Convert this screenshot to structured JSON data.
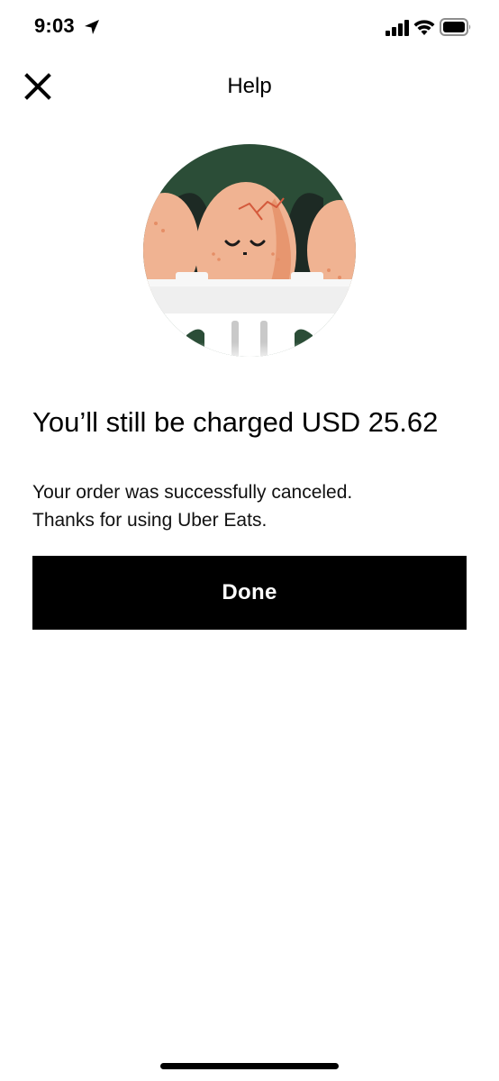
{
  "status_bar": {
    "time": "9:03",
    "icons": [
      "location-arrow-icon",
      "cellular-signal-icon",
      "wifi-icon",
      "battery-icon"
    ]
  },
  "nav": {
    "close_icon": "close-icon",
    "title": "Help"
  },
  "illustration": {
    "name": "cracked-egg-illustration",
    "colors": {
      "background_green": "#2b4d37",
      "egg": "#f0b392",
      "egg_shadow": "#e58e66",
      "carton": "#f2f2f2"
    }
  },
  "content": {
    "headline": "You’ll still be charged USD 25.62",
    "message_line1": "Your order was successfully canceled.",
    "message_line2": "Thanks for using Uber Eats."
  },
  "actions": {
    "done_label": "Done"
  },
  "colors": {
    "primary_button_bg": "#000000",
    "primary_button_text": "#ffffff",
    "background": "#ffffff"
  }
}
